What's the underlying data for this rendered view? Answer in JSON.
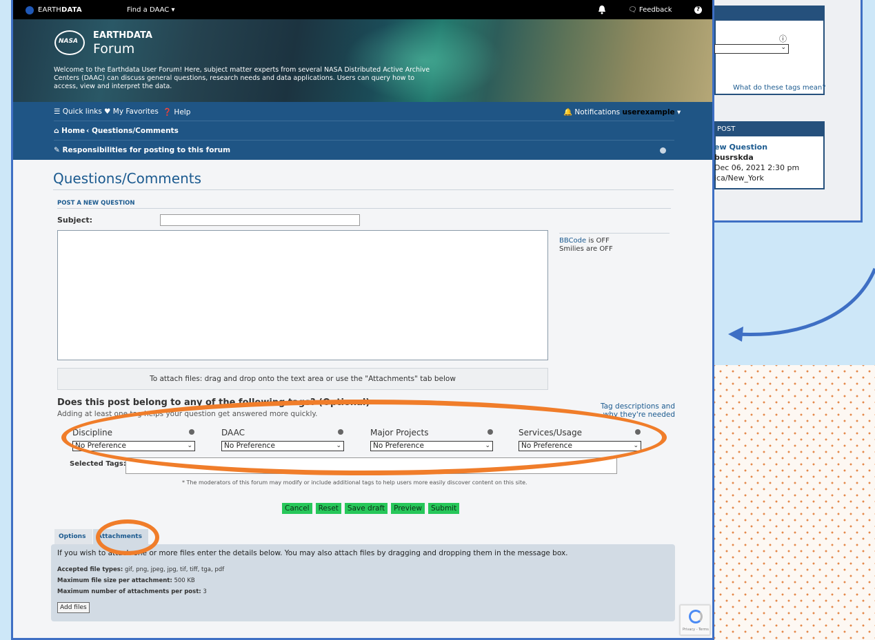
{
  "topbar": {
    "logo": "NASA",
    "brand_plain": "EARTH",
    "brand_bold": "DATA",
    "find_daac": "Find a DAAC",
    "feedback": "Feedback"
  },
  "banner": {
    "logo_text": "NASA",
    "title": "EARTHDATA",
    "subtitle": "Forum",
    "welcome": "Welcome to the Earthdata User Forum! Here, subject matter experts from several NASA Distributed Active Archive Centers (DAAC) can discuss general questions, research needs and data applications. Users can query how to access, view and interpret the data."
  },
  "nav": {
    "quick_links": "Quick links",
    "favorites": "My Favorites",
    "help": "Help",
    "notifications": "Notifications",
    "username": "userexample",
    "breadcrumb_home": "Home",
    "breadcrumb_current": "Questions/Comments",
    "responsibilities": "Responsibilities for posting to this forum"
  },
  "page": {
    "title": "Questions/Comments",
    "section": "POST A NEW QUESTION",
    "subject_label": "Subject:",
    "bbcode_prefix": "BBCode",
    "bbcode_rest": " is OFF",
    "smilies": "Smilies are OFF",
    "attach_hint": "To attach files: drag and drop onto the text area or use the \"Attachments\" tab below"
  },
  "tags": {
    "question": "Does this post belong to any of the following tags? (Optional)",
    "subtext": "Adding at least one tag helps your question get answered more quickly.",
    "descriptions_link": "Tag descriptions and why they're needed",
    "fields": [
      {
        "label": "Discipline",
        "value": "No Preference"
      },
      {
        "label": "DAAC",
        "value": "No Preference"
      },
      {
        "label": "Major Projects",
        "value": "No Preference"
      },
      {
        "label": "Services/Usage",
        "value": "No Preference"
      }
    ],
    "selected_label": "Selected Tags:",
    "moderator_note": "* The moderators of this forum may modify or include additional tags to help users more easily discover content on this site."
  },
  "buttons": {
    "cancel": "Cancel",
    "reset": "Reset",
    "save_draft": "Save draft",
    "preview": "Preview",
    "submit": "Submit"
  },
  "tabs": {
    "options": "Options",
    "attachments": "Attachments"
  },
  "attachments": {
    "intro": "If you wish to attach one or more files enter the details below. You may also attach files by dragging and dropping them in the message box.",
    "types_label": "Accepted file types:",
    "types_value": "gif, png, jpeg, jpg, tif, tiff, tga, pdf",
    "size_label": "Maximum file size per attachment:",
    "size_value": "500 KB",
    "count_label": "Maximum number of attachments per post:",
    "count_value": "3",
    "add_files": "Add files"
  },
  "recaptcha_text": "Privacy - Terms",
  "background_panel": {
    "tag_link": "What do these tags mean?",
    "post_header": "POST",
    "post_title": "ew Question",
    "post_user": "busrskda",
    "post_date": "Dec 06, 2021 2:30 pm",
    "post_tz": "ica/New_York"
  },
  "colors": {
    "nav_blue": "#1f5585",
    "accent_orange": "#f07d2a",
    "button_green": "#27c75a",
    "frame_blue": "#3e6fc4"
  }
}
